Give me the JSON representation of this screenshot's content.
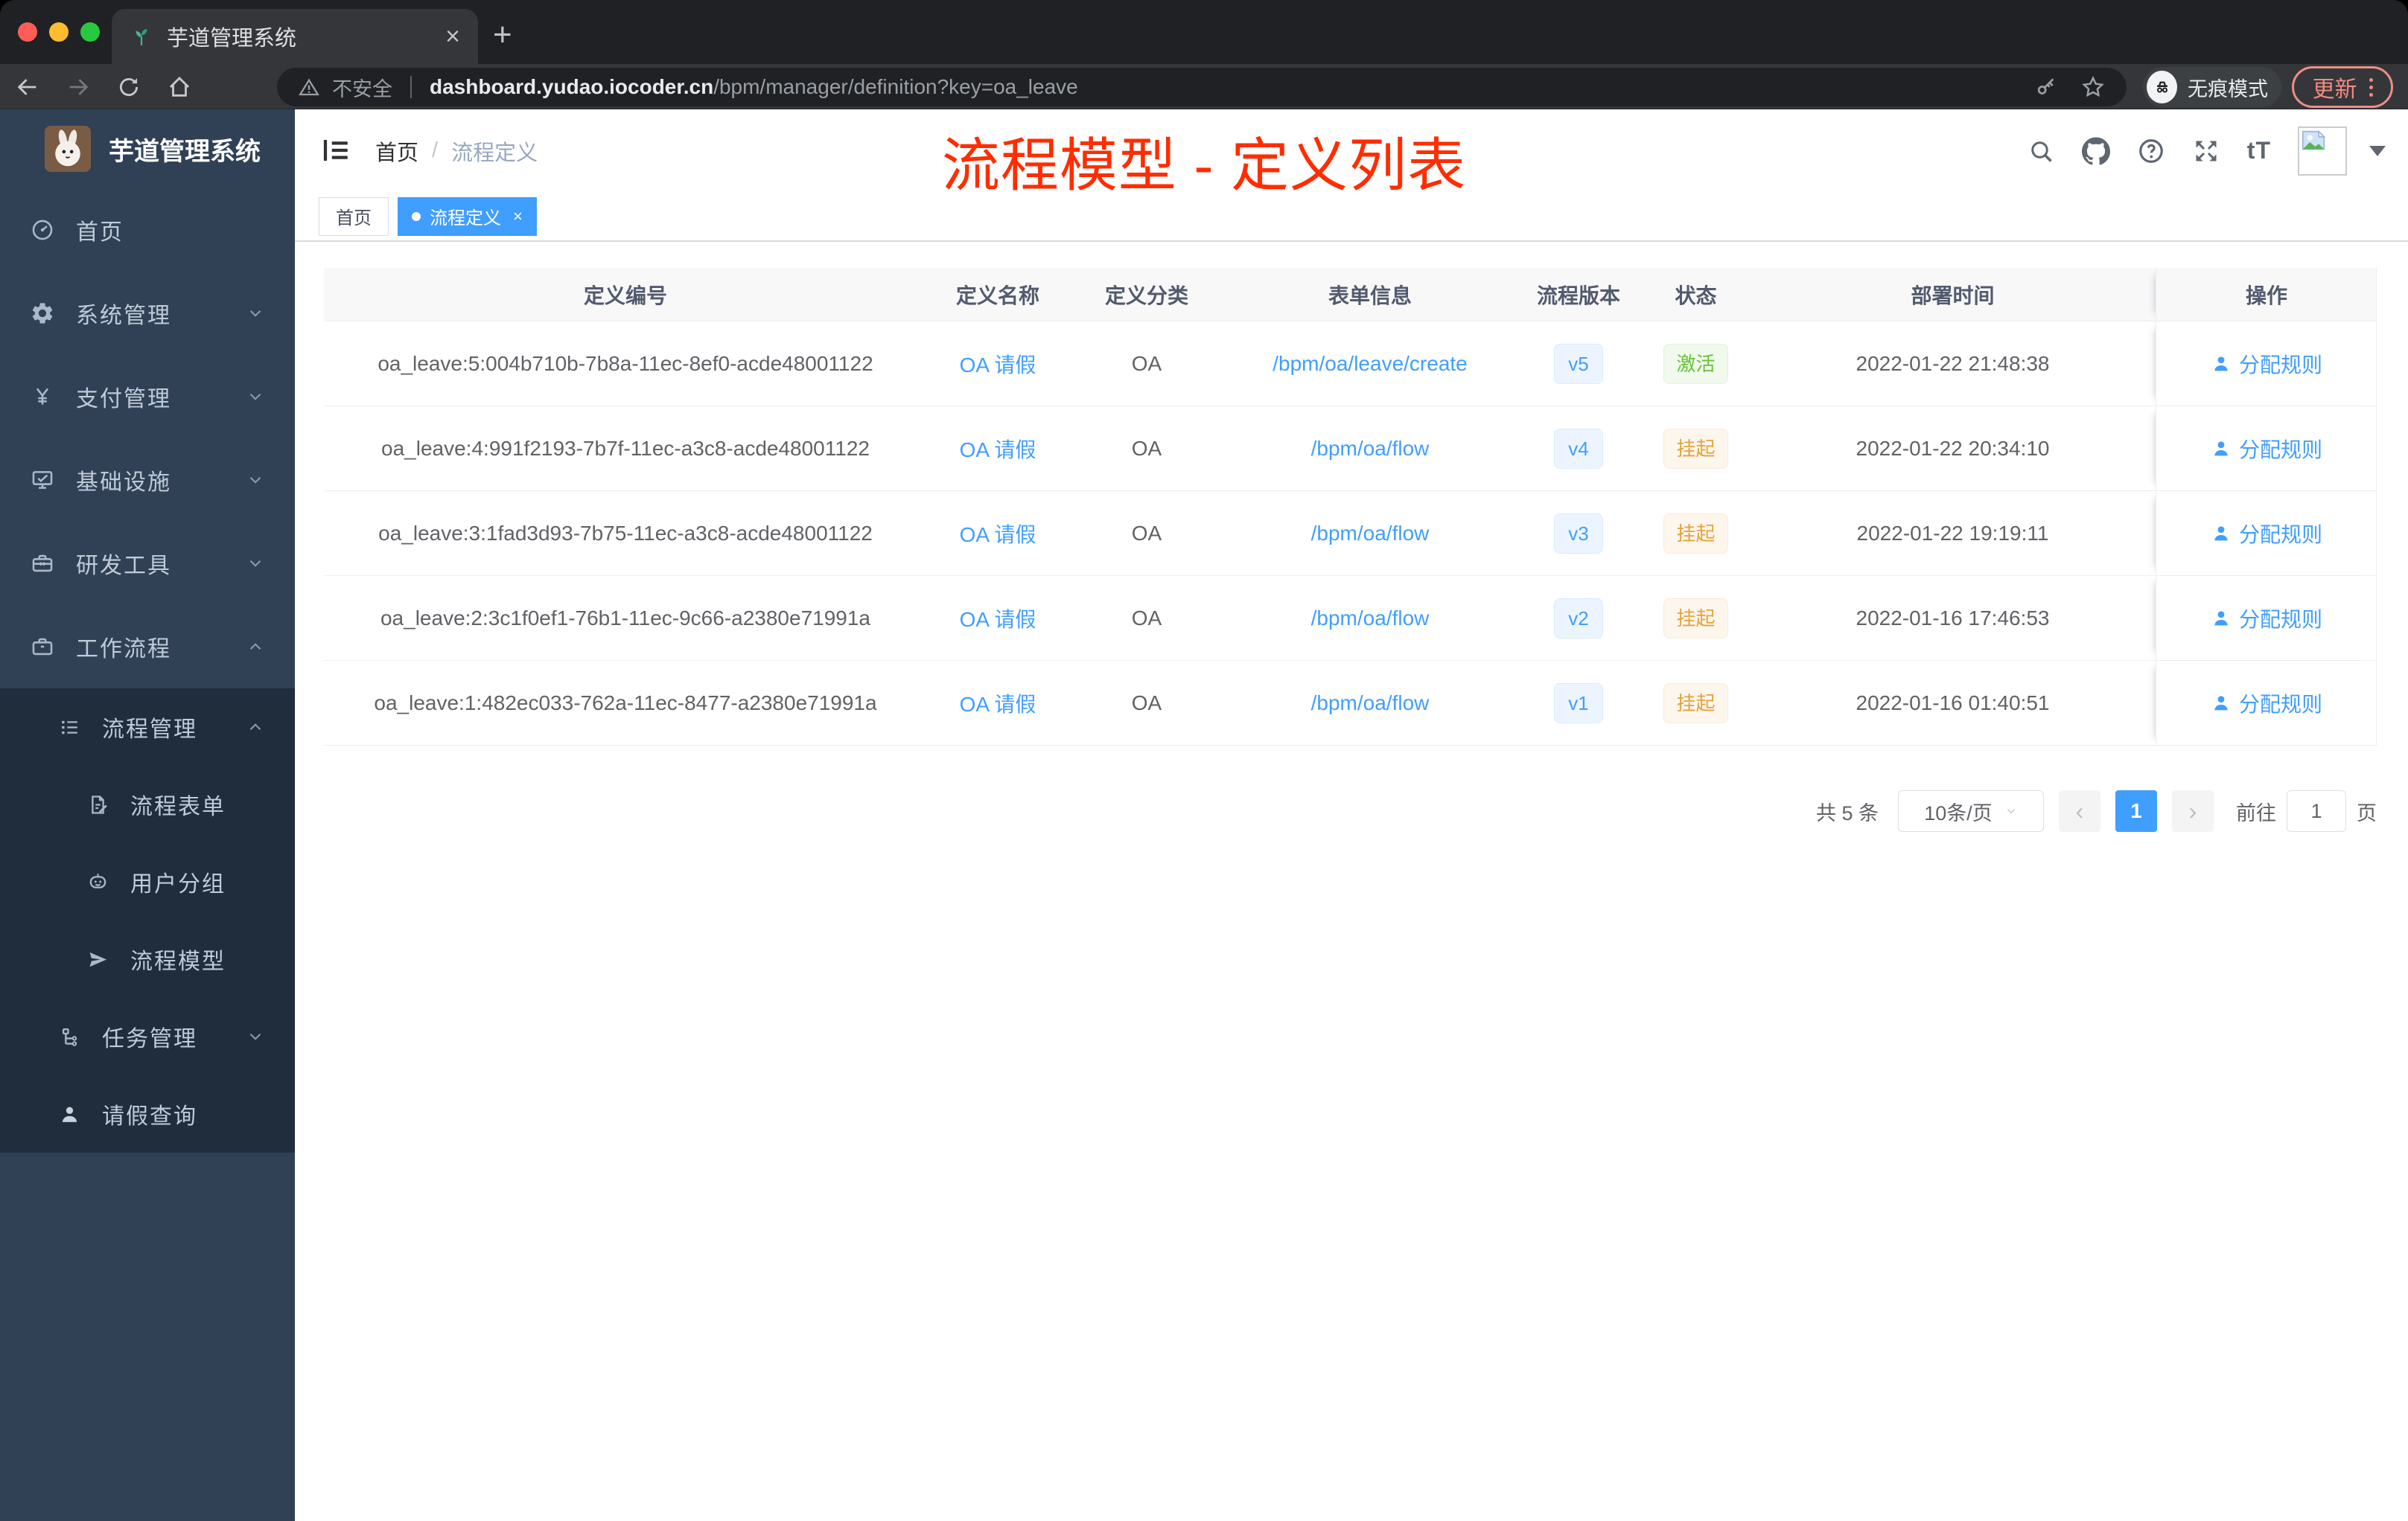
{
  "browser": {
    "tab_title": "芋道管理系统",
    "new_tab": "+",
    "close_tab": "×",
    "security_label": "不安全",
    "url_host": "dashboard.yudao.iocoder.cn",
    "url_path": "/bpm/manager/definition?key=oa_leave",
    "incognito_label": "无痕模式",
    "update_label": "更新"
  },
  "sidebar": {
    "logo_title": "芋道管理系统",
    "menu": [
      {
        "label": "首页",
        "icon": "dashboard-icon"
      },
      {
        "label": "系统管理",
        "icon": "gear-icon"
      },
      {
        "label": "支付管理",
        "icon": "yen-icon"
      },
      {
        "label": "基础设施",
        "icon": "monitor-icon"
      },
      {
        "label": "研发工具",
        "icon": "toolbox-icon"
      },
      {
        "label": "工作流程",
        "icon": "briefcase-icon"
      },
      {
        "label": "流程管理",
        "icon": "list-icon"
      },
      {
        "label": "流程表单",
        "icon": "form-icon"
      },
      {
        "label": "用户分组",
        "icon": "robot-icon"
      },
      {
        "label": "流程模型",
        "icon": "paper-plane-icon"
      },
      {
        "label": "任务管理",
        "icon": "tree-icon"
      },
      {
        "label": "请假查询",
        "icon": "user-icon"
      }
    ]
  },
  "header": {
    "breadcrumb_home": "首页",
    "breadcrumb_separator": "/",
    "breadcrumb_current": "流程定义",
    "annotation": "流程模型 - 定义列表",
    "text_size_icon_label": "tT"
  },
  "tags": {
    "home": "首页",
    "active": "流程定义",
    "close": "×"
  },
  "table": {
    "columns": [
      "定义编号",
      "定义名称",
      "定义分类",
      "表单信息",
      "流程版本",
      "状态",
      "部署时间",
      "操作"
    ],
    "action_label": "分配规则",
    "rows": [
      {
        "id": "oa_leave:5:004b710b-7b8a-11ec-8ef0-acde48001122",
        "name": "OA 请假",
        "category": "OA",
        "form": "/bpm/oa/leave/create",
        "version": "v5",
        "status": "激活",
        "status_type": "success",
        "time": "2022-01-22 21:48:38"
      },
      {
        "id": "oa_leave:4:991f2193-7b7f-11ec-a3c8-acde48001122",
        "name": "OA 请假",
        "category": "OA",
        "form": "/bpm/oa/flow",
        "version": "v4",
        "status": "挂起",
        "status_type": "warning",
        "time": "2022-01-22 20:34:10"
      },
      {
        "id": "oa_leave:3:1fad3d93-7b75-11ec-a3c8-acde48001122",
        "name": "OA 请假",
        "category": "OA",
        "form": "/bpm/oa/flow",
        "version": "v3",
        "status": "挂起",
        "status_type": "warning",
        "time": "2022-01-22 19:19:11"
      },
      {
        "id": "oa_leave:2:3c1f0ef1-76b1-11ec-9c66-a2380e71991a",
        "name": "OA 请假",
        "category": "OA",
        "form": "/bpm/oa/flow",
        "version": "v2",
        "status": "挂起",
        "status_type": "warning",
        "time": "2022-01-16 17:46:53"
      },
      {
        "id": "oa_leave:1:482ec033-762a-11ec-8477-a2380e71991a",
        "name": "OA 请假",
        "category": "OA",
        "form": "/bpm/oa/flow",
        "version": "v1",
        "status": "挂起",
        "status_type": "warning",
        "time": "2022-01-16 01:40:51"
      }
    ]
  },
  "pagination": {
    "total": "共 5 条",
    "page_size": "10条/页",
    "prev": "‹",
    "next": "›",
    "current_page": "1",
    "goto_label": "前往",
    "goto_value": "1",
    "page_unit": "页"
  },
  "colors": {
    "accent": "#409eff",
    "success": "#67c23a",
    "warning": "#e6a23c",
    "annotation_red": "#ff2d00",
    "sidebar_bg": "#304156",
    "sidebar_submenu_bg": "#1f2d3d",
    "update_button": "#f28b82"
  }
}
